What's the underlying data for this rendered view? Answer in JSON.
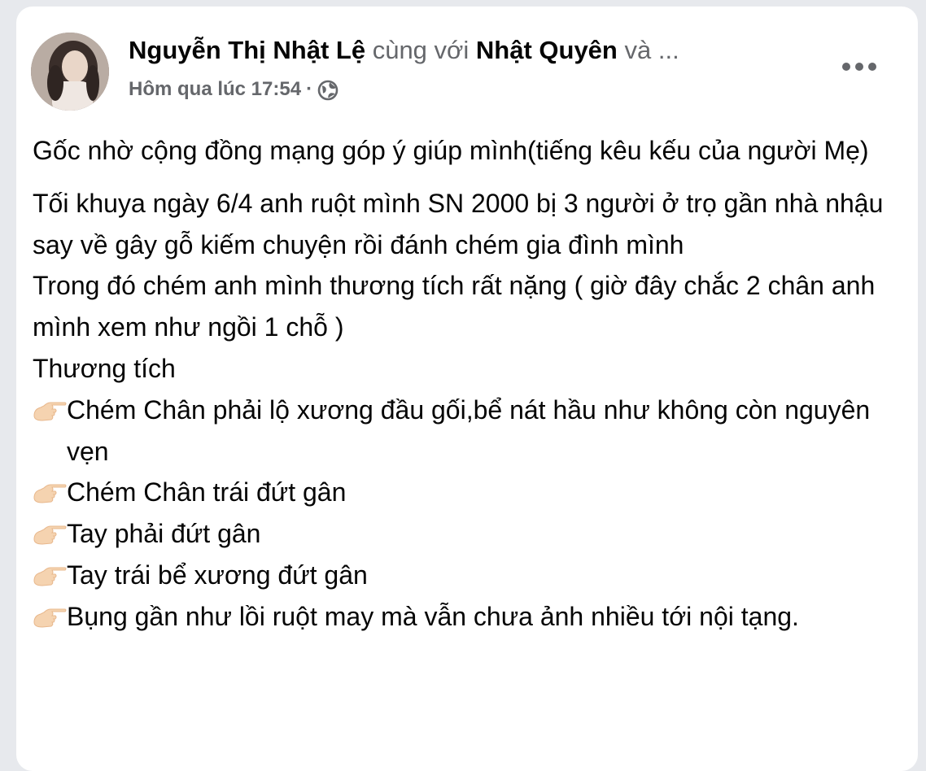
{
  "post": {
    "author": "Nguyễn Thị Nhật Lệ",
    "with_text": "cùng với",
    "tagged": "Nhật Quyên",
    "and_more": "và ...",
    "timestamp": "Hôm qua lúc 17:54",
    "separator": "·",
    "privacy_icon": "globe-icon",
    "more_icon": "more-options-icon",
    "paragraphs": [
      "Gốc nhờ cộng đồng mạng góp ý giúp mình(tiếng kêu kếu của người Mẹ)"
    ],
    "lines": [
      "Tối khuya ngày 6/4 anh ruột mình SN 2000 bị 3 người ở trọ gần nhà nhậu say về gây gỗ kiếm chuyện rồi đánh chém gia đình mình",
      "Trong đó chém anh mình thương tích rất nặng ( giờ đây chắc 2 chân anh mình xem như ngồi 1 chỗ )",
      "Thương tích"
    ],
    "bullets": [
      "Chém Chân phải lộ xương đầu gối,bể nát hầu như không còn nguyên vẹn",
      "Chém Chân trái đứt gân",
      "Tay phải đứt gân",
      "Tay trái bể xương đứt gân",
      "Bụng gần như lồi ruột may mà vẫn chưa ảnh nhiều tới nội tạng."
    ],
    "bullet_icon": "pointing-hand-icon"
  }
}
